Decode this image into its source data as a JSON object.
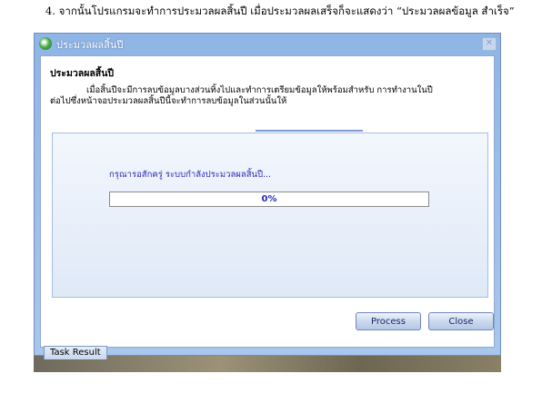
{
  "caption": "4. จากนั้นโปรแกรมจะทำการประมวลผลสิ้นปี เมื่อประมวลผลเสร็จก็จะแสดงว่า “ประมวลผลข้อมูล สำเร็จ”",
  "window": {
    "title": "ประมวลผลสิ้นปี",
    "close_glyph": "✕",
    "title_icon": "app-globe-icon"
  },
  "content": {
    "heading": "ประมวลผลสิ้นปี",
    "desc_line1": "เมื่อสิ้นปีจะมีการลบข้อมูลบางส่วนทิ้งไปและทำการเตรียมข้อมูลให้พร้อมสำหรับ การทำงานในปี",
    "desc_line2": "ต่อไปซึ่งหน้าจอประมวลผลสิ้นปีนี้จะทำการลบข้อมูลในส่วนนั้นให้"
  },
  "progress": {
    "status_text": "กรุณารอสักครู่ ระบบกำลังประมวลผลสิ้นปี...",
    "value": 0,
    "label": "0%"
  },
  "buttons": {
    "process": "Process",
    "close": "Close"
  },
  "taskbar": {
    "task_result": "Task Result"
  },
  "colors": {
    "window_frame": "#a9c6ec",
    "progress_text": "#2a2ab8"
  }
}
